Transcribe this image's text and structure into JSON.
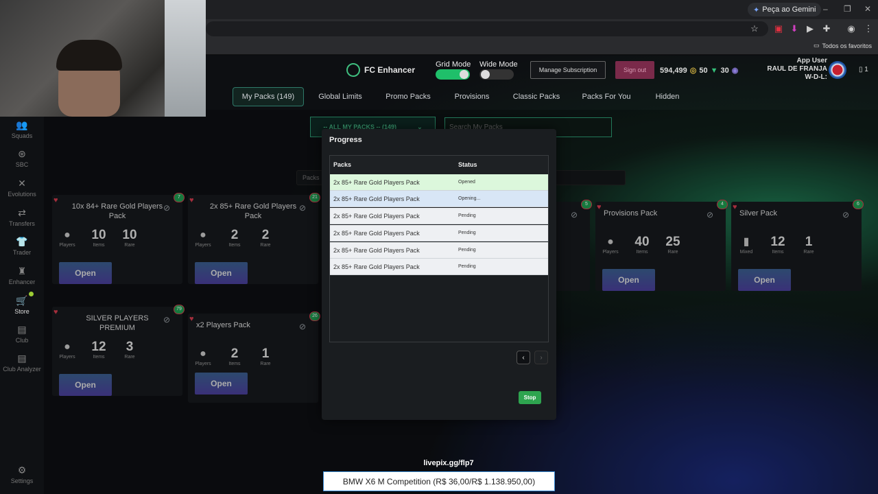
{
  "browser": {
    "gemini_label": "Peça ao Gemini",
    "bookmarks_all": "Todos os favoritos"
  },
  "header": {
    "brand": "FC Enhancer",
    "grid_mode_label": "Grid Mode",
    "wide_mode_label": "Wide Mode",
    "manage_subscription": "Manage Subscription",
    "sign_out": "Sign out",
    "coins": "594,499",
    "points": "50",
    "tokens": "30",
    "user_role": "App User",
    "user_name": "RAUL DE FRANJA",
    "user_wdl": "W-D-L:",
    "phone_count": "1"
  },
  "tabs": [
    {
      "label": "My Packs (149)"
    },
    {
      "label": "Global Limits"
    },
    {
      "label": "Promo Packs"
    },
    {
      "label": "Provisions"
    },
    {
      "label": "Classic Packs"
    },
    {
      "label": "Packs For You"
    },
    {
      "label": "Hidden"
    }
  ],
  "sidebar": [
    {
      "label": "Squads"
    },
    {
      "label": "SBC"
    },
    {
      "label": "Evolutions"
    },
    {
      "label": "Transfers"
    },
    {
      "label": "Trader"
    },
    {
      "label": "Enhancer"
    },
    {
      "label": "Store"
    },
    {
      "label": "Club"
    },
    {
      "label": "Club Analyzer"
    },
    {
      "label": "Settings"
    }
  ],
  "filters": {
    "category": "-- ALL MY PACKS -- (149)",
    "search_placeholder": "Search My Packs",
    "sort_label": "Packs"
  },
  "packs": [
    {
      "title": "10x 84+ Rare Gold Players Pack",
      "count": "7",
      "stats": [
        {
          "value": "10",
          "label": "Players"
        },
        {
          "value": "10",
          "label": "Items"
        },
        {
          "value": "10",
          "label": "Rare"
        }
      ],
      "open": "Open"
    },
    {
      "title": "2x 85+ Rare Gold Players Pack",
      "count": "21",
      "stats": [
        {
          "value": "2",
          "label": "Players"
        },
        {
          "value": "2",
          "label": "Items"
        },
        {
          "value": "2",
          "label": "Rare"
        }
      ],
      "open": "Open"
    },
    {
      "title": "",
      "count": "5",
      "stats": [],
      "open": ""
    },
    {
      "title": "Provisions Pack",
      "count": "4",
      "stats": [
        {
          "value": "40",
          "label": "Players"
        },
        {
          "value": "40",
          "label": "Items"
        },
        {
          "value": "25",
          "label": "Rare"
        }
      ],
      "open": "Open"
    },
    {
      "title": "Silver Pack",
      "count": "6",
      "stats": [
        {
          "value": "",
          "label": "Mixed"
        },
        {
          "value": "12",
          "label": "Items"
        },
        {
          "value": "1",
          "label": "Rare"
        }
      ],
      "open": "Open"
    },
    {
      "title": "SILVER PLAYERS PREMIUM",
      "count": "79",
      "stats": [
        {
          "value": "",
          "label": "Players"
        },
        {
          "value": "12",
          "label": "Items"
        },
        {
          "value": "3",
          "label": "Rare"
        }
      ],
      "open": "Open"
    },
    {
      "title": "x2 Players Pack",
      "count": "26",
      "stats": [
        {
          "value": "",
          "label": "Players"
        },
        {
          "value": "2",
          "label": "Items"
        },
        {
          "value": "1",
          "label": "Rare"
        }
      ],
      "open": "Open"
    }
  ],
  "progress": {
    "title": "Progress",
    "col_packs": "Packs",
    "col_status": "Status",
    "rows": [
      {
        "pack": "2x 85+ Rare Gold Players Pack",
        "status": "Opened"
      },
      {
        "pack": "2x 85+ Rare Gold Players Pack",
        "status": "Opening..."
      },
      {
        "pack": "2x 85+ Rare Gold Players Pack",
        "status": "Pending"
      },
      {
        "pack": "2x 85+ Rare Gold Players Pack",
        "status": "Pending"
      },
      {
        "pack": "2x 85+ Rare Gold Players Pack",
        "status": "Pending"
      },
      {
        "pack": "2x 85+ Rare Gold Players Pack",
        "status": "Pending"
      }
    ],
    "stop": "Stop"
  },
  "stream": {
    "link": "livepix.gg/flp7",
    "goal": "BMW X6 M Competition (R$ 36,00/R$ 1.138.950,00)"
  },
  "colors": {
    "accent_green": "#2ea44f",
    "toggle_on": "#1fbf6a",
    "sign_out_bg": "#7a2a4a"
  }
}
